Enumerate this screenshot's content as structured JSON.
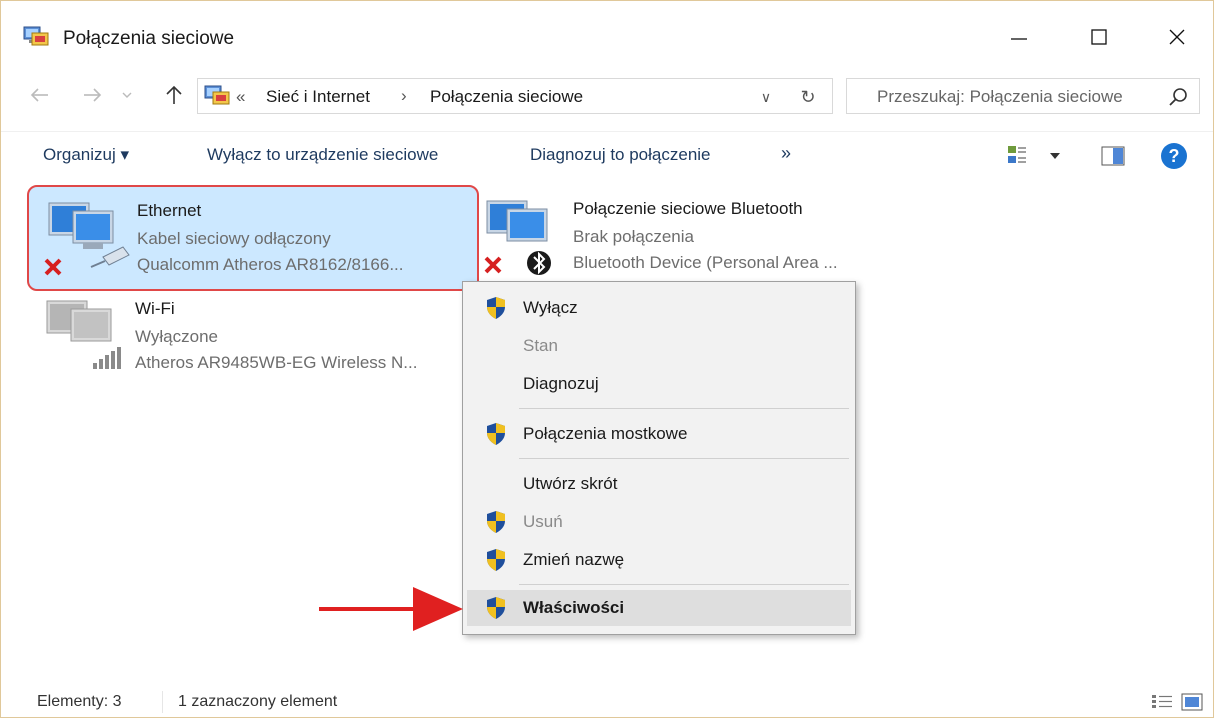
{
  "window": {
    "title": "Połączenia sieciowe",
    "icon": "network-connections-icon"
  },
  "address": {
    "overflow_chevron": "«",
    "crumbs": [
      "Sieć i Internet",
      "Połączenia sieciowe"
    ],
    "separator": "›",
    "dropdown_glyph": "∨",
    "refresh_glyph": "↻"
  },
  "search": {
    "placeholder": "Przeszukaj: Połączenia sieciowe"
  },
  "toolbar": {
    "organize_label": "Organizuj ▾",
    "disable_label": "Wyłącz to urządzenie sieciowe",
    "diagnose_label": "Diagnozuj to połączenie",
    "more_label": "»",
    "help_label": "?"
  },
  "connections": [
    {
      "name": "Ethernet",
      "status": "Kabel sieciowy odłączony",
      "device": "Qualcomm Atheros AR8162/8166...",
      "selected": true,
      "disconnected": true
    },
    {
      "name": "Połączenie sieciowe Bluetooth",
      "status": "Brak połączenia",
      "device": "Bluetooth Device (Personal Area ...",
      "selected": false,
      "disconnected": true
    },
    {
      "name": "Wi-Fi",
      "status": "Wyłączone",
      "device": "Atheros AR9485WB-EG Wireless N...",
      "selected": false,
      "disconnected": false
    }
  ],
  "context_menu": {
    "items": [
      {
        "label": "Wyłącz",
        "shield": true,
        "enabled": true,
        "bold": false
      },
      {
        "label": "Stan",
        "shield": false,
        "enabled": false,
        "bold": false
      },
      {
        "label": "Diagnozuj",
        "shield": false,
        "enabled": true,
        "bold": false
      },
      {
        "label": "Połączenia mostkowe",
        "shield": true,
        "enabled": true,
        "bold": false
      },
      {
        "label": "Utwórz skrót",
        "shield": false,
        "enabled": true,
        "bold": false
      },
      {
        "label": "Usuń",
        "shield": true,
        "enabled": false,
        "bold": false
      },
      {
        "label": "Zmień nazwę",
        "shield": true,
        "enabled": true,
        "bold": false
      },
      {
        "label": "Właściwości",
        "shield": true,
        "enabled": true,
        "bold": true,
        "highlighted": true
      }
    ]
  },
  "status_bar": {
    "count": "Elementy: 3",
    "selection": "1 zaznaczony element"
  },
  "colors": {
    "selection_bg": "#cce8ff",
    "annotation_red": "#e02020",
    "shield_blue": "#1f4f9c",
    "shield_yellow": "#f0c020",
    "help_blue": "#1a73d1"
  }
}
